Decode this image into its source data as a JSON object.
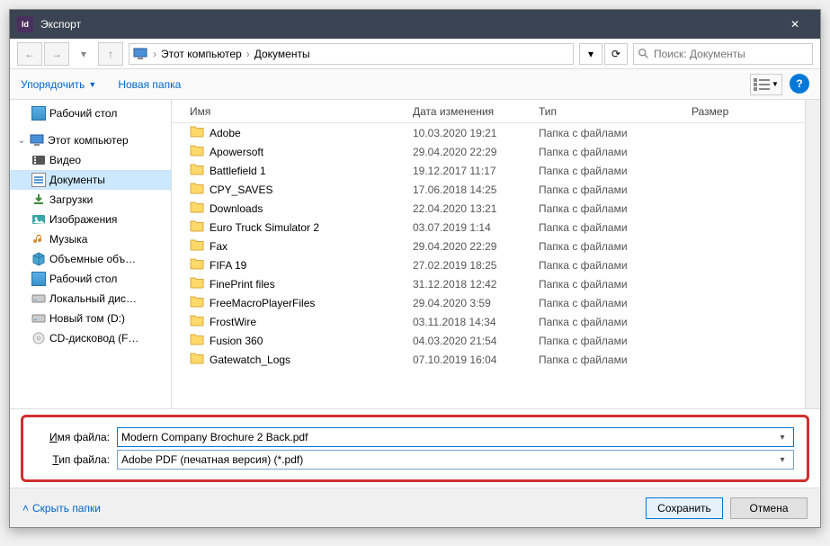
{
  "titlebar": {
    "app_icon_text": "Id",
    "title": "Экспорт"
  },
  "nav": {
    "breadcrumb": [
      "Этот компьютер",
      "Документы"
    ],
    "search_placeholder": "Поиск: Документы"
  },
  "toolbar": {
    "organize": "Упорядочить",
    "new_folder": "Новая папка"
  },
  "tree": {
    "desktop": "Рабочий стол",
    "this_pc": "Этот компьютер",
    "video": "Видео",
    "documents": "Документы",
    "downloads": "Загрузки",
    "pictures": "Изображения",
    "music": "Музыка",
    "objects3d": "Объемные объ…",
    "desktop2": "Рабочий стол",
    "localdisk": "Локальный дис…",
    "newvol": "Новый том (D:)",
    "cdrom": "CD-дисковод (F…"
  },
  "columns": {
    "name": "Имя",
    "date": "Дата изменения",
    "type": "Тип",
    "size": "Размер"
  },
  "rows": [
    {
      "name": "Adobe",
      "date": "10.03.2020 19:21",
      "type": "Папка с файлами"
    },
    {
      "name": "Apowersoft",
      "date": "29.04.2020 22:29",
      "type": "Папка с файлами"
    },
    {
      "name": "Battlefield 1",
      "date": "19.12.2017 11:17",
      "type": "Папка с файлами"
    },
    {
      "name": "CPY_SAVES",
      "date": "17.06.2018 14:25",
      "type": "Папка с файлами"
    },
    {
      "name": "Downloads",
      "date": "22.04.2020 13:21",
      "type": "Папка с файлами"
    },
    {
      "name": "Euro Truck Simulator 2",
      "date": "03.07.2019 1:14",
      "type": "Папка с файлами"
    },
    {
      "name": "Fax",
      "date": "29.04.2020 22:29",
      "type": "Папка с файлами"
    },
    {
      "name": "FIFA 19",
      "date": "27.02.2019 18:25",
      "type": "Папка с файлами"
    },
    {
      "name": "FinePrint files",
      "date": "31.12.2018 12:42",
      "type": "Папка с файлами"
    },
    {
      "name": "FreeMacroPlayerFiles",
      "date": "29.04.2020 3:59",
      "type": "Папка с файлами"
    },
    {
      "name": "FrostWire",
      "date": "03.11.2018 14:34",
      "type": "Папка с файлами"
    },
    {
      "name": "Fusion 360",
      "date": "04.03.2020 21:54",
      "type": "Папка с файлами"
    },
    {
      "name": "Gatewatch_Logs",
      "date": "07.10.2019 16:04",
      "type": "Папка с файлами"
    }
  ],
  "fields": {
    "filename_label": "Имя файла:",
    "filename_value": "Modern Company Brochure 2 Back.pdf",
    "filetype_label": "Тип файла:",
    "filetype_value": "Adobe PDF (печатная версия) (*.pdf)"
  },
  "footer": {
    "hide_folders": "Скрыть папки",
    "save": "Сохранить",
    "cancel": "Отмена"
  }
}
